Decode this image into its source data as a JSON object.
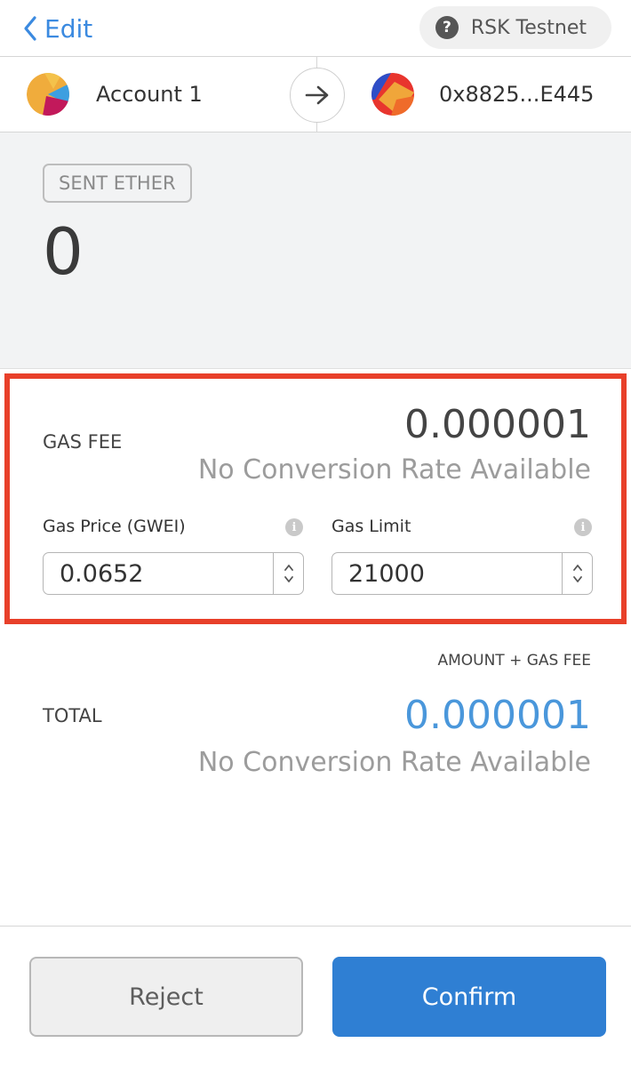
{
  "header": {
    "back_label": "Edit",
    "network_label": "RSK Testnet",
    "network_help_glyph": "?"
  },
  "accounts": {
    "from_name": "Account 1",
    "to_address": "0x8825...E445"
  },
  "sent": {
    "badge": "SENT ETHER",
    "amount": "0"
  },
  "gas": {
    "label": "GAS FEE",
    "value": "0.000001",
    "conversion": "No Conversion Rate Available",
    "price_label": "Gas Price (GWEI)",
    "price_value": "0.0652",
    "limit_label": "Gas Limit",
    "limit_value": "21000",
    "info_glyph": "i"
  },
  "total": {
    "sublabel": "AMOUNT + GAS FEE",
    "label": "TOTAL",
    "value": "0.000001",
    "conversion": "No Conversion Rate Available"
  },
  "buttons": {
    "reject": "Reject",
    "confirm": "Confirm"
  },
  "colors": {
    "accent_blue": "#2f7fd3",
    "total_value_blue": "#4a97db",
    "highlight_red": "#e8402a"
  },
  "icons": {
    "back": "chevron-left-icon",
    "network_help": "question-circle-icon",
    "transfer": "arrow-right-icon",
    "info": "info-icon",
    "stepper_up": "chevron-up-icon",
    "stepper_down": "chevron-down-icon"
  }
}
